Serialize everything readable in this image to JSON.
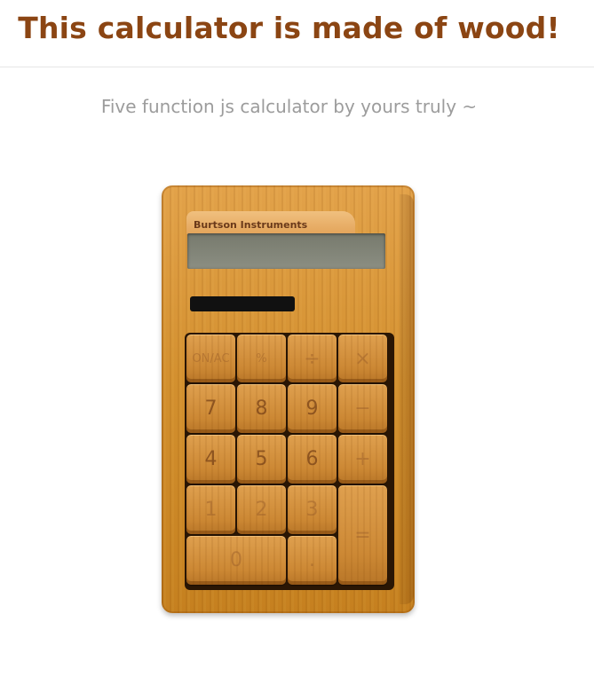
{
  "header": {
    "title": "This calculator is made of wood!",
    "subtitle": "Five function js calculator by yours truly ~"
  },
  "calculator": {
    "brand": "Burtson Instruments",
    "keys": [
      {
        "label": "ON/AC"
      },
      {
        "label": "%"
      },
      {
        "label": "÷"
      },
      {
        "label": "×"
      },
      {
        "label": "7"
      },
      {
        "label": "8"
      },
      {
        "label": "9"
      },
      {
        "label": "−"
      },
      {
        "label": "4"
      },
      {
        "label": "5"
      },
      {
        "label": "6"
      },
      {
        "label": "+"
      },
      {
        "label": "1"
      },
      {
        "label": "2"
      },
      {
        "label": "3"
      },
      {
        "label": "="
      },
      {
        "label": "0"
      },
      {
        "label": "."
      }
    ]
  },
  "colors": {
    "title": "#8b4513",
    "subtitle": "#9c9c9c",
    "wood": "#d3902f"
  }
}
